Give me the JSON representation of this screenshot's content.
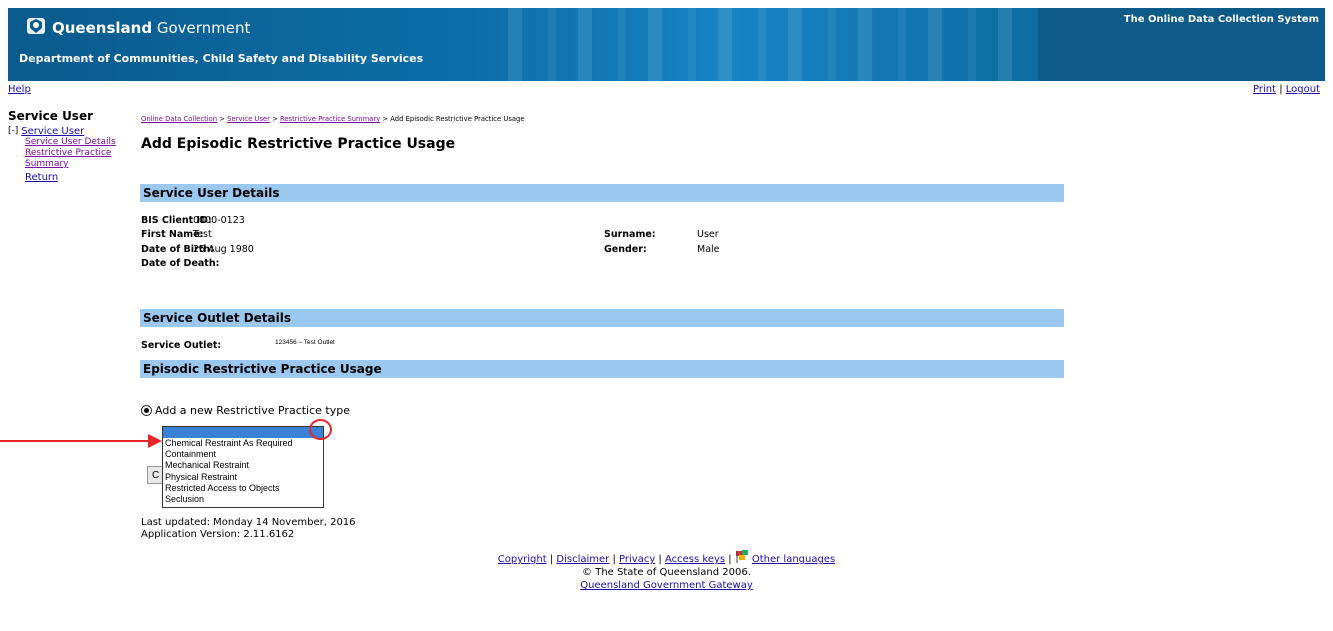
{
  "header": {
    "brand_bold": "Queensland",
    "brand_rest": " Government",
    "department": "Department of Communities, Child Safety and Disability Services",
    "system_name": "The Online Data Collection System"
  },
  "links": {
    "help": "Help",
    "print": "Print",
    "separator": " | ",
    "logout": "Logout"
  },
  "sidebar": {
    "title": "Service User",
    "toggle": "[-]",
    "service_user": "Service User",
    "service_user_details": "Service User Details",
    "restrictive_practice_summary": "Restrictive Practice Summary",
    "return": "Return"
  },
  "breadcrumb": {
    "online_data_collection": "Online Data Collection",
    "service_user": "Service User",
    "restrictive_practice_summary": "Restrictive Practice Summary",
    "current": "Add Episodic Restrictive Practice Usage",
    "separator": " > "
  },
  "page_title": "Add Episodic Restrictive Practice Usage",
  "service_user_details": {
    "heading": "Service User Details",
    "bis_label": "BIS Client ID:",
    "bis_value": "0000-0123",
    "first_name_label": "First Name:",
    "first_name_value": "Test",
    "dob_label": "Date of Birth:",
    "dob_value": "26 Aug 1980",
    "dod_label": "Date of Death:",
    "surname_label": "Surname:",
    "surname_value": "User",
    "gender_label": "Gender:",
    "gender_value": "Male"
  },
  "service_outlet_details": {
    "heading": "Service Outlet Details",
    "outlet_label": "Service Outlet:",
    "outlet_value": "123456 – Test Outlet"
  },
  "episodic_usage": {
    "heading": "Episodic Restrictive Practice Usage",
    "radio_label": "Add a new Restrictive Practice type",
    "button_label": "C",
    "dropdown_options": [
      "Chemical Restraint As Required",
      "Containment",
      "Mechanical Restraint",
      "Physical Restraint",
      "Restricted Access to Objects",
      "Seclusion"
    ]
  },
  "footer": {
    "last_updated": "Last updated: Monday 14 November, 2016",
    "app_version": "Application Version: 2.11.6162",
    "copyright": "Copyright",
    "disclaimer": "Disclaimer",
    "privacy": "Privacy",
    "access_keys": "Access keys",
    "other_languages": "Other languages",
    "sep": " | ",
    "state": "© The State of Queensland 2006.",
    "gateway": "Queensland Government Gateway"
  },
  "colors": {
    "section_bar": "#9bc8f0",
    "header_blue": "#0c6ea8",
    "annotation_red": "#e8262a",
    "dropdown_highlight": "#3a82d6",
    "visited_link": "#7b0aa0"
  },
  "icons": [
    "queensland-crest-icon",
    "flags-icon",
    "red-arrow-annotation",
    "red-circle-annotation"
  ]
}
